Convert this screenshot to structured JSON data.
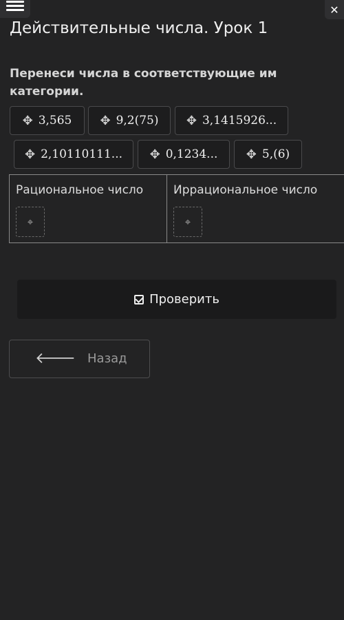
{
  "header": {
    "menu_icon": "hamburger-icon",
    "close_icon": "close-icon",
    "title": "Действительные числа. Урок 1"
  },
  "task": {
    "instruction": "Перенеси числа в соответствующие им категории."
  },
  "chips": [
    {
      "label": "3,565",
      "icon": "move-icon"
    },
    {
      "label": "9,2(75)",
      "icon": "move-icon"
    },
    {
      "label": "3,1415926...",
      "icon": "move-icon"
    },
    {
      "label": "2,10110111...",
      "icon": "move-icon"
    },
    {
      "label": "0,1234...",
      "icon": "move-icon"
    },
    {
      "label": "5,(6)",
      "icon": "move-icon"
    }
  ],
  "categories": [
    {
      "header": "Рациональное число",
      "drop_icon": "move-target-icon"
    },
    {
      "header": "Иррациональное число",
      "drop_icon": "move-target-icon"
    }
  ],
  "buttons": {
    "check_label": "Проверить",
    "back_label": "Назад"
  },
  "colors": {
    "background": "#232324",
    "chip_background": "#1d1d1e",
    "button_background": "#1a1a1b"
  }
}
